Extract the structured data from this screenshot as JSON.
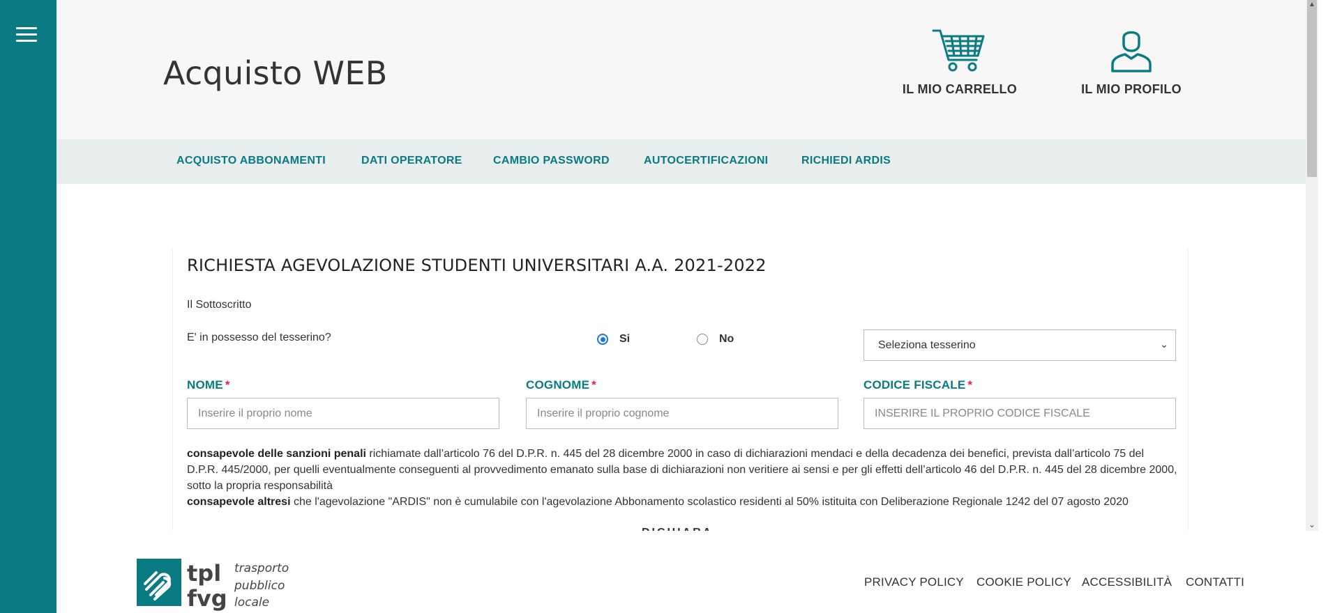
{
  "header": {
    "title": "Acquisto WEB",
    "cart_label": "IL MIO CARRELLO",
    "profile_label": "IL MIO PROFILO",
    "icons": {
      "cart": "cart-icon",
      "profile": "user-icon",
      "menu": "hamburger-menu-icon"
    }
  },
  "nav": {
    "items": [
      {
        "label": "ACQUISTO ABBONAMENTI"
      },
      {
        "label": "DATI OPERATORE"
      },
      {
        "label": "CAMBIO PASSWORD"
      },
      {
        "label": "AUTOCERTIFICAZIONI"
      },
      {
        "label": "RICHIEDI ARDIS"
      }
    ]
  },
  "form": {
    "title": "RICHIESTA AGEVOLAZIONE STUDENTI UNIVERSITARI A.A. 2021-2022",
    "subtitle": "Il Sottoscritto",
    "tesserino_question": "E' in possesso del tesserino?",
    "radio_si": "Si",
    "radio_no": "No",
    "radio_selected": "Si",
    "tesserino_select": "Seleziona tesserino",
    "nome_label": "NOME",
    "cognome_label": "COGNOME",
    "cf_label": "CODICE FISCALE",
    "required_mark": "*",
    "nome_placeholder": "Inserire il proprio nome",
    "cognome_placeholder": "Inserire il proprio cognome",
    "cf_placeholder": "INSERIRE IL PROPRIO CODICE FISCALE",
    "nome_value": "",
    "cognome_value": "",
    "cf_value": "",
    "para1_bold": "consapevole delle sanzioni penali",
    "para1_text": " richiamate dall’articolo 76 del D.P.R. n. 445 del 28 dicembre 2000 in caso di dichiarazioni mendaci e della decadenza dei benefici, prevista dall’articolo 75 del D.P.R. 445/2000, per quelli eventualmente conseguenti al provvedimento emanato sulla base di dichiarazioni non veritiere ai sensi e per gli effetti dell’articolo 46 del D.P.R. n. 445 del 28 dicembre 2000, sotto la propria responsabilità",
    "para2_bold": "consapevole altresi",
    "para2_text": " che l'agevolazione \"ARDIS\" non è cumulabile con l'agevolazione Abbonamento scolastico residenti al 50% istituita con Deliberazione Regionale 1242 del 07 agosto 2020",
    "dichiara": "DICHIARA"
  },
  "footer": {
    "logo_text": [
      "tpl",
      "fvg",
      "trasporto",
      "pubblico",
      "locale"
    ],
    "links": [
      {
        "label": "PRIVACY POLICY"
      },
      {
        "label": "COOKIE POLICY"
      },
      {
        "label": "ACCESSIBILITÀ"
      },
      {
        "label": "CONTATTI"
      }
    ]
  },
  "colors": {
    "brand_teal": "#0a7a83",
    "required_red": "#d9264b",
    "radio_blue": "#1a73e8"
  }
}
